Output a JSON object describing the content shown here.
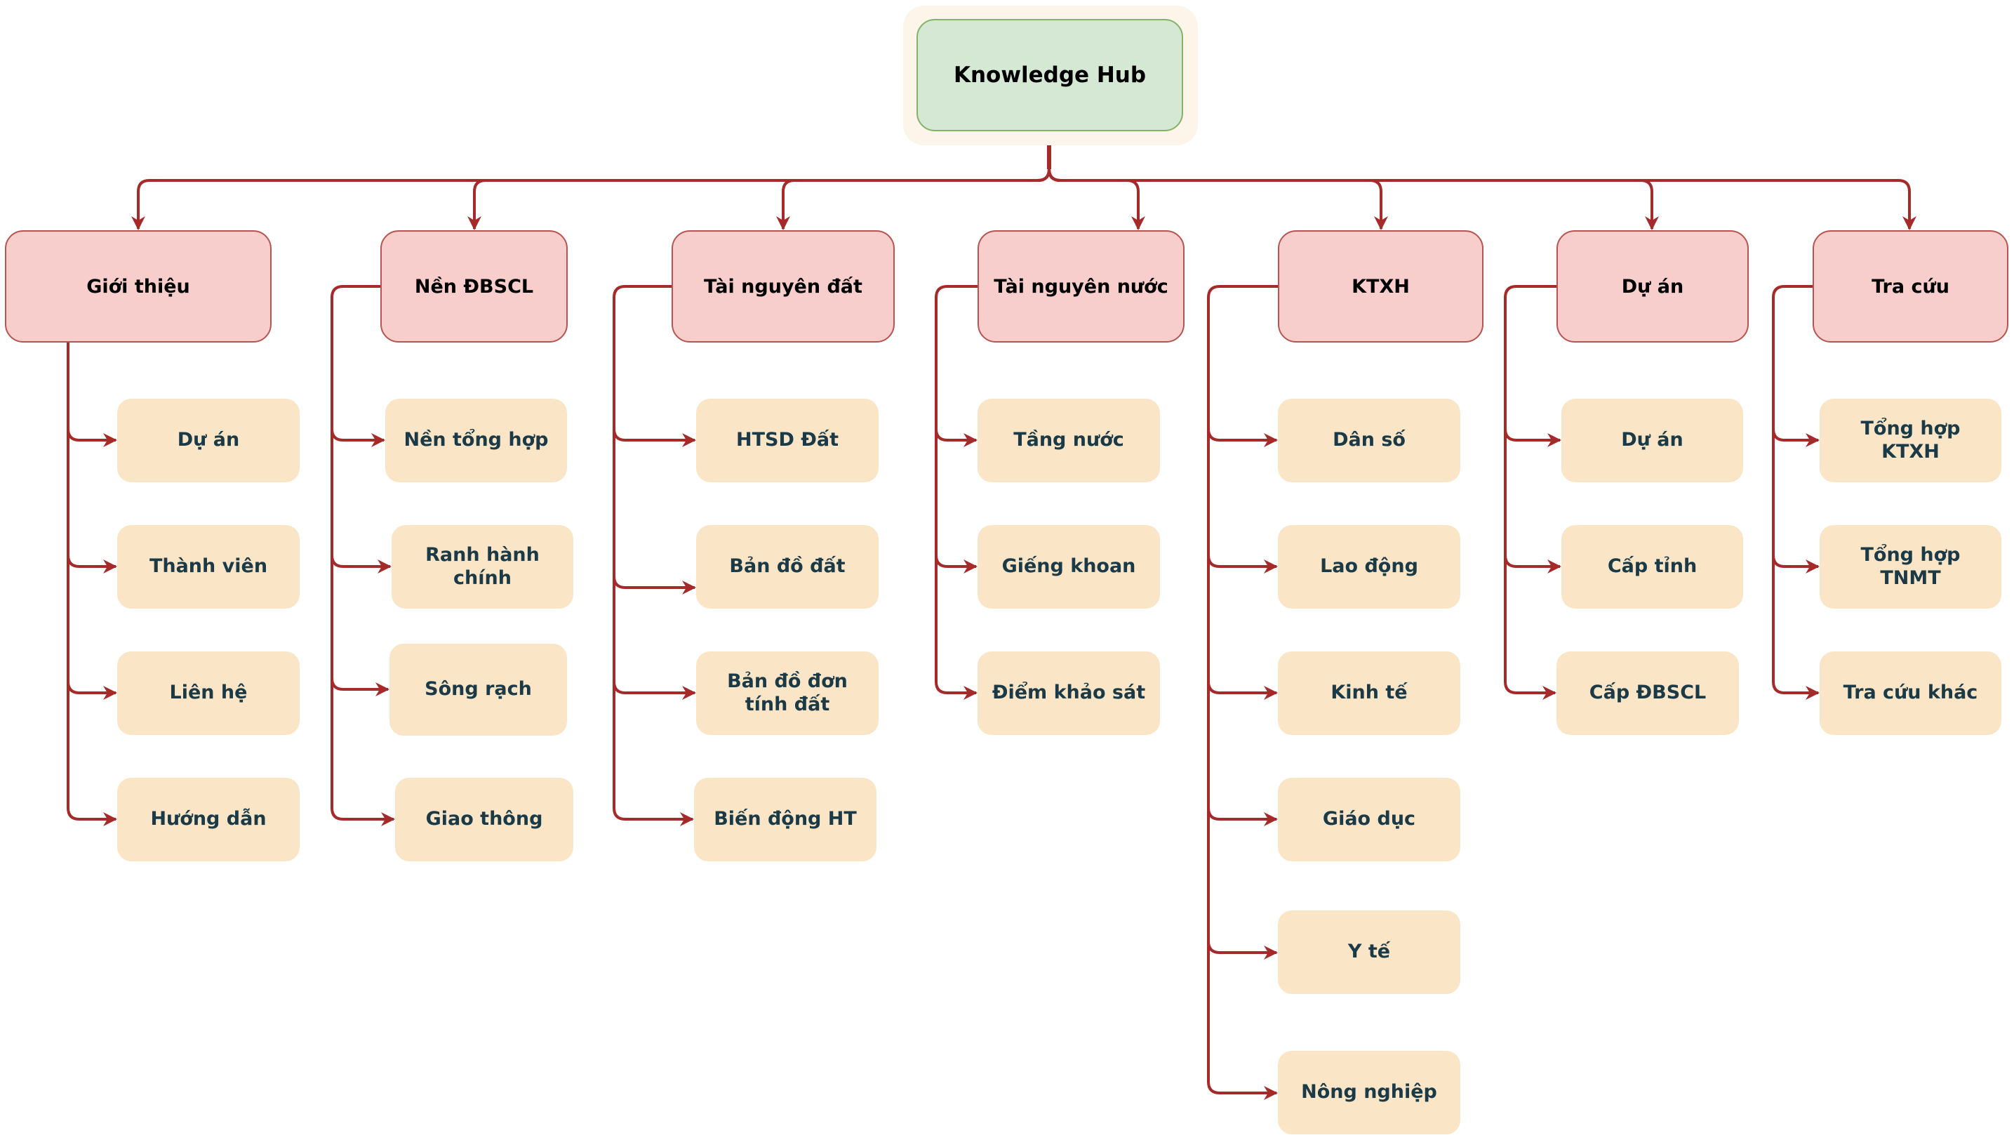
{
  "diagram": {
    "root": {
      "label": "Knowledge Hub"
    },
    "colors": {
      "root_fill": "#d5e8d4",
      "root_border": "#82b366",
      "parent_fill": "#f8cecc",
      "parent_border": "#b85450",
      "child_fill": "#fae5c6",
      "child_text": "#1b3a47",
      "connector": "#a52a2a"
    },
    "branches": [
      {
        "label": "Giới thiệu",
        "children": [
          "Dự án",
          "Thành viên",
          "Liên hệ",
          "Hướng dẫn"
        ]
      },
      {
        "label": "Nền ĐBSCL",
        "children": [
          "Nền tổng hợp",
          "Ranh hành chính",
          "Sông rạch",
          "Giao thông"
        ]
      },
      {
        "label": "Tài nguyên đất",
        "children": [
          "HTSD Đất",
          "Bản đồ đất",
          "Bản đồ đơn tính đất",
          "Biến động HT"
        ]
      },
      {
        "label": "Tài nguyên nước",
        "children": [
          "Tầng nước",
          "Giếng khoan",
          "Điểm khảo sát"
        ]
      },
      {
        "label": "KTXH",
        "children": [
          "Dân số",
          "Lao động",
          "Kinh tế",
          "Giáo dục",
          "Y tế",
          "Nông nghiệp"
        ]
      },
      {
        "label": "Dự án",
        "children": [
          "Dự án",
          "Cấp tỉnh",
          "Cấp ĐBSCL"
        ]
      },
      {
        "label": "Tra cứu",
        "children": [
          "Tổng hợp KTXH",
          "Tổng hợp TNMT",
          "Tra cứu khác"
        ]
      }
    ]
  }
}
